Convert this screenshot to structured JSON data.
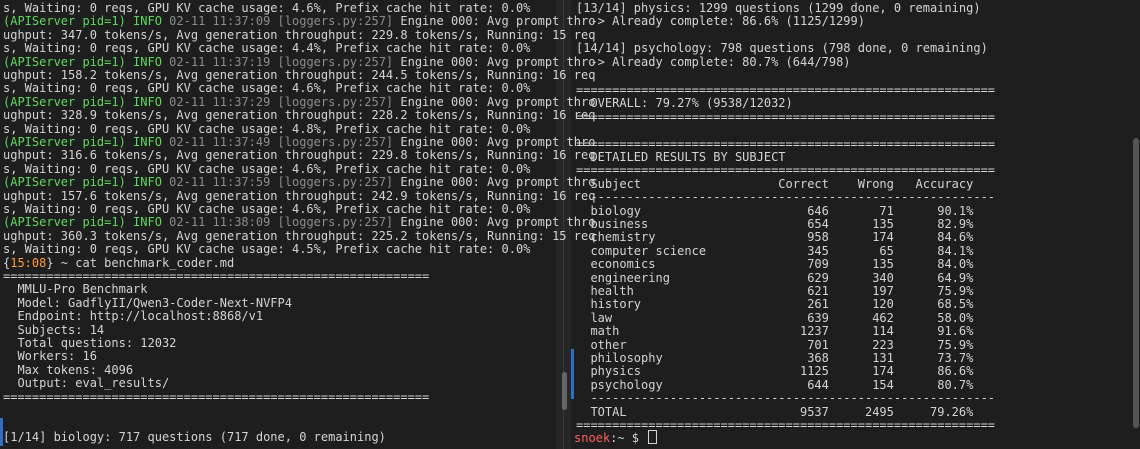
{
  "left_terminal": {
    "log_lines": [
      {
        "prefix": "",
        "meta": "",
        "text": "s, Waiting: 0 reqs, GPU KV cache usage: 4.6%, Prefix cache hit rate: 0.0%"
      },
      {
        "prefix": "(APIServer pid=1) INFO",
        "meta": " 02-11 11:37:09 [loggers.py:257]",
        "text": " Engine 000: Avg prompt thro"
      },
      {
        "prefix": "",
        "meta": "",
        "text": "ughput: 347.0 tokens/s, Avg generation throughput: 229.8 tokens/s, Running: 15 req"
      },
      {
        "prefix": "",
        "meta": "",
        "text": "s, Waiting: 0 reqs, GPU KV cache usage: 4.4%, Prefix cache hit rate: 0.0%"
      },
      {
        "prefix": "(APIServer pid=1) INFO",
        "meta": " 02-11 11:37:19 [loggers.py:257]",
        "text": " Engine 000: Avg prompt thro"
      },
      {
        "prefix": "",
        "meta": "",
        "text": "ughput: 158.2 tokens/s, Avg generation throughput: 244.5 tokens/s, Running: 16 req"
      },
      {
        "prefix": "",
        "meta": "",
        "text": "s, Waiting: 0 reqs, GPU KV cache usage: 4.6%, Prefix cache hit rate: 0.0%"
      },
      {
        "prefix": "(APIServer pid=1) INFO",
        "meta": " 02-11 11:37:29 [loggers.py:257]",
        "text": " Engine 000: Avg prompt thro"
      },
      {
        "prefix": "",
        "meta": "",
        "text": "ughput: 328.9 tokens/s, Avg generation throughput: 228.2 tokens/s, Running: 16 req"
      },
      {
        "prefix": "",
        "meta": "",
        "text": "s, Waiting: 0 reqs, GPU KV cache usage: 4.8%, Prefix cache hit rate: 0.0%"
      },
      {
        "prefix": "(APIServer pid=1) INFO",
        "meta": " 02-11 11:37:49 [loggers.py:257]",
        "text": " Engine 000: Avg prompt thro"
      },
      {
        "prefix": "",
        "meta": "",
        "text": "ughput: 316.6 tokens/s, Avg generation throughput: 229.8 tokens/s, Running: 16 req"
      },
      {
        "prefix": "",
        "meta": "",
        "text": "s, Waiting: 0 reqs, GPU KV cache usage: 4.6%, Prefix cache hit rate: 0.0%"
      },
      {
        "prefix": "(APIServer pid=1) INFO",
        "meta": " 02-11 11:37:59 [loggers.py:257]",
        "text": " Engine 000: Avg prompt thro"
      },
      {
        "prefix": "",
        "meta": "",
        "text": "ughput: 157.6 tokens/s, Avg generation throughput: 242.9 tokens/s, Running: 16 req"
      },
      {
        "prefix": "",
        "meta": "",
        "text": "s, Waiting: 0 reqs, GPU KV cache usage: 4.6%, Prefix cache hit rate: 0.0%"
      },
      {
        "prefix": "(APIServer pid=1) INFO",
        "meta": " 02-11 11:38:09 [loggers.py:257]",
        "text": " Engine 000: Avg prompt thro"
      },
      {
        "prefix": "",
        "meta": "",
        "text": "ughput: 360.3 tokens/s, Avg generation throughput: 225.2 tokens/s, Running: 15 req"
      },
      {
        "prefix": "",
        "meta": "",
        "text": "s, Waiting: 0 reqs, GPU KV cache usage: 4.5%, Prefix cache hit rate: 0.0%"
      }
    ],
    "prompt_open": "{",
    "prompt_time": "15:08",
    "prompt_close": "} ~ ",
    "command": "cat benchmark_coder.md",
    "rule": "===========================================================",
    "benchmark_lines": [
      "  MMLU-Pro Benchmark",
      "  Model: GadflyII/Qwen3-Coder-Next-NVFP4",
      "  Endpoint: http://localhost:8868/v1",
      "  Subjects: 14",
      "  Total questions: 12032",
      "  Workers: 16",
      "  Max tokens: 4096",
      "  Output: eval_results/"
    ],
    "progress_line": "[1/14] biology: 717 questions (717 done, 0 remaining)"
  },
  "right_terminal": {
    "top_lines": [
      "[13/14] physics: 1299 questions (1299 done, 0 remaining)",
      "  -> Already complete: 86.6% (1125/1299)",
      "",
      "[14/14] psychology: 798 questions (798 done, 0 remaining)",
      "  -> Already complete: 80.7% (644/798)",
      "",
      ""
    ],
    "rule": "==========================================================",
    "overall": "  OVERALL: 79.27% (9538/12032)",
    "section_title": "  DETAILED RESULTS BY SUBJECT",
    "header": "  Subject                   Correct    Wrong   Accuracy",
    "dash_rule": "  --------------------------------------------------------",
    "rows": [
      {
        "subject": "biology",
        "correct": "646",
        "wrong": "71",
        "accuracy": "90.1%"
      },
      {
        "subject": "business",
        "correct": "654",
        "wrong": "135",
        "accuracy": "82.9%"
      },
      {
        "subject": "chemistry",
        "correct": "958",
        "wrong": "174",
        "accuracy": "84.6%"
      },
      {
        "subject": "computer science",
        "correct": "345",
        "wrong": "65",
        "accuracy": "84.1%"
      },
      {
        "subject": "economics",
        "correct": "709",
        "wrong": "135",
        "accuracy": "84.0%"
      },
      {
        "subject": "engineering",
        "correct": "629",
        "wrong": "340",
        "accuracy": "64.9%"
      },
      {
        "subject": "health",
        "correct": "621",
        "wrong": "197",
        "accuracy": "75.9%"
      },
      {
        "subject": "history",
        "correct": "261",
        "wrong": "120",
        "accuracy": "68.5%"
      },
      {
        "subject": "law",
        "correct": "639",
        "wrong": "462",
        "accuracy": "58.0%"
      },
      {
        "subject": "math",
        "correct": "1237",
        "wrong": "114",
        "accuracy": "91.6%"
      },
      {
        "subject": "other",
        "correct": "701",
        "wrong": "223",
        "accuracy": "75.9%"
      },
      {
        "subject": "philosophy",
        "correct": "368",
        "wrong": "131",
        "accuracy": "73.7%"
      },
      {
        "subject": "physics",
        "correct": "1125",
        "wrong": "174",
        "accuracy": "86.6%"
      },
      {
        "subject": "psychology",
        "correct": "644",
        "wrong": "154",
        "accuracy": "80.7%"
      }
    ],
    "total": {
      "subject": "TOTAL",
      "correct": "9537",
      "wrong": "2495",
      "accuracy": "79.26%"
    },
    "prompt_user": "snoek",
    "prompt_rest": ":~ $ "
  }
}
